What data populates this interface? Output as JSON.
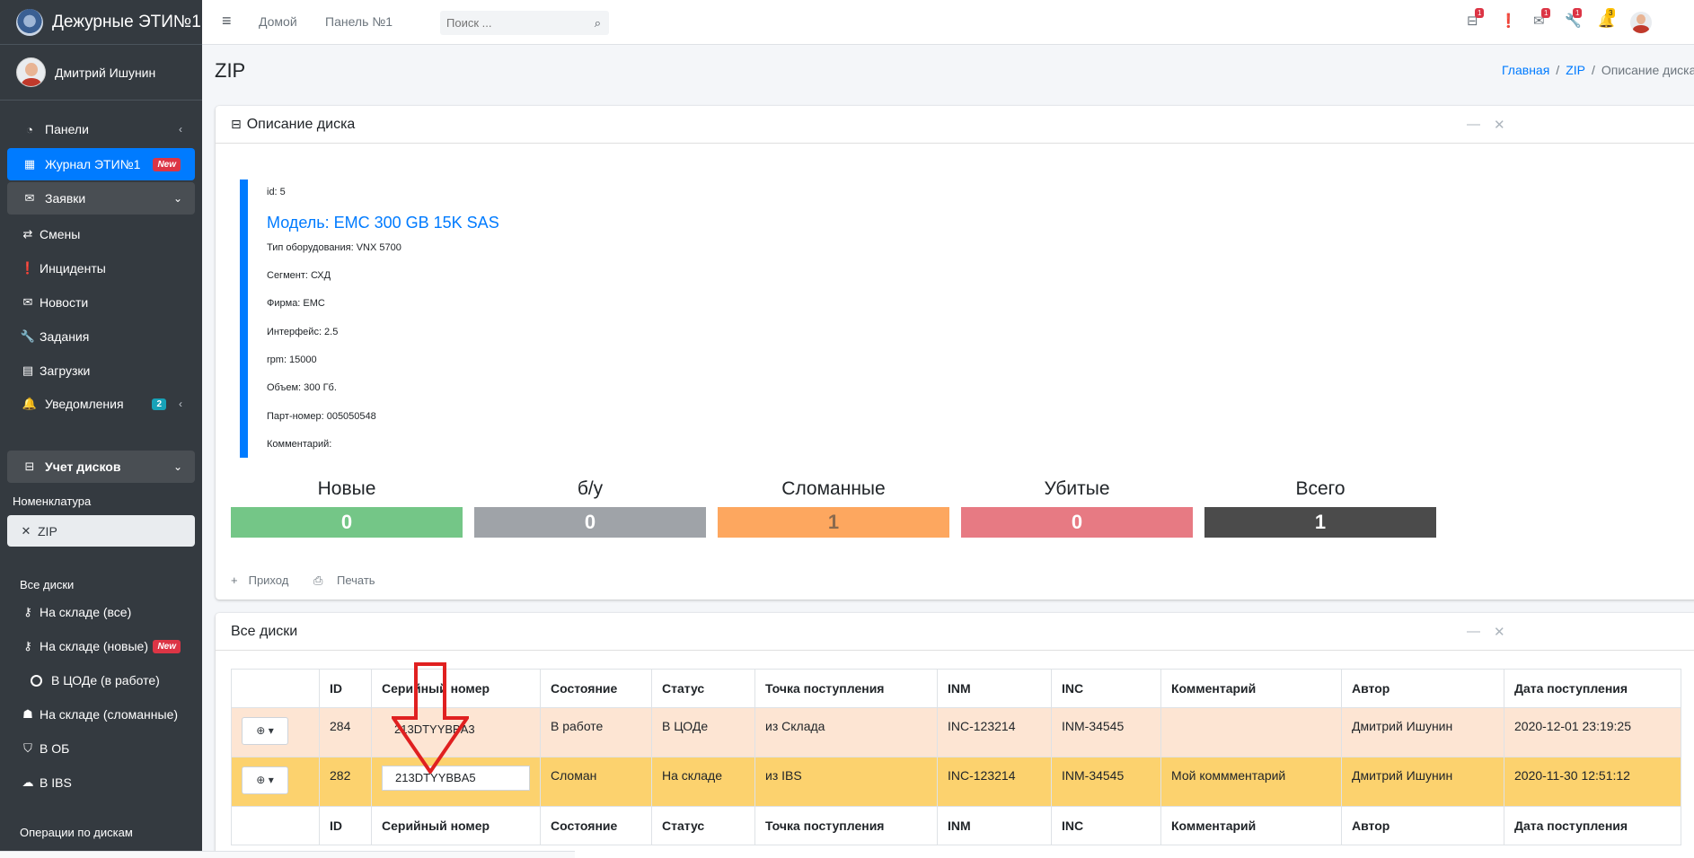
{
  "brand": {
    "title": "Дежурные ЭТИ№1"
  },
  "user": {
    "name": "Дмитрий Ишунин"
  },
  "sidebar": {
    "items": [
      {
        "label": "Панели",
        "icon": "dashboard-icon"
      },
      {
        "label": "Журнал ЭТИ№1",
        "badge": "New",
        "icon": "grid-icon"
      },
      {
        "label": "Заявки",
        "icon": "envelope-icon"
      },
      {
        "label": "Смены",
        "icon": "exchange-icon"
      },
      {
        "label": "Инциденты",
        "icon": "exclamation-circle-icon"
      },
      {
        "label": "Новости",
        "icon": "envelope-open-icon"
      },
      {
        "label": "Задания",
        "icon": "wrench-icon"
      },
      {
        "label": "Загрузки",
        "icon": "file-icon"
      },
      {
        "label": "Уведомления",
        "badge": "2",
        "icon": "bell-icon"
      },
      {
        "label": "Учет дисков",
        "icon": "hdd-icon"
      }
    ],
    "nomenclature_header": "Номенклатура",
    "zip_item": "ZIP",
    "all_disks_header": "Все диски",
    "disk_items": [
      {
        "label": "На складе (все)",
        "icon": "key-icon"
      },
      {
        "label": "На складе (новые)",
        "badge": "New",
        "icon": "key-icon"
      },
      {
        "label": "В ЦОДе (в работе)",
        "icon": "circle-icon"
      },
      {
        "label": "На складе (сломанные)",
        "icon": "user-injured-icon"
      },
      {
        "label": "В ОБ",
        "icon": "shield-icon"
      },
      {
        "label": "В IBS",
        "icon": "cloud-icon"
      }
    ],
    "operations_header": "Операции по дискам"
  },
  "navbar": {
    "home": "Домой",
    "panel": "Панель №1",
    "search_placeholder": "Поиск ...",
    "badges": [
      "1",
      "1",
      "1",
      "3"
    ]
  },
  "page": {
    "title": "ZIP",
    "breadcrumb": [
      "Главная",
      "ZIP",
      "Описание диска"
    ]
  },
  "disk": {
    "card_title": "Описание диска",
    "id_line": "id: 5",
    "model": "Модель: EMC 300 GB 15K SAS",
    "type": "Тип оборудования: VNX 5700",
    "segment": "Сегмент: СХД",
    "vendor": "Фирма: EMC",
    "interface": "Интерфейс: 2.5",
    "rpm": "rpm: 15000",
    "volume": "Объем: 300 Гб.",
    "part": "Парт-номер: 005050548",
    "comment": "Комментарий:"
  },
  "stats": [
    {
      "label": "Новые",
      "value": "0",
      "color": "#74c687",
      "text": "#ffffff"
    },
    {
      "label": "б/у",
      "value": "0",
      "color": "#9fa3a8",
      "text": "#ffffff"
    },
    {
      "label": "Сломанные",
      "value": "1",
      "color": "#fda75f",
      "text": "#8a6a4e"
    },
    {
      "label": "Убитые",
      "value": "0",
      "color": "#e77a83",
      "text": "#ffffff"
    },
    {
      "label": "Всего",
      "value": "1",
      "color": "#4b4b4b",
      "text": "#ffffff"
    }
  ],
  "actions": {
    "income": "Приход",
    "print": "Печать"
  },
  "table": {
    "card_title": "Все диски",
    "columns": [
      "ID",
      "Серийный номер",
      "Состояние",
      "Статус",
      "Точка поступления",
      "INM",
      "INC",
      "Комментарий",
      "Автор",
      "Дата поступления"
    ],
    "rows": [
      {
        "id": "284",
        "serial": "213DTYYBBA3",
        "state": "В работе",
        "status": "В ЦОДе",
        "source": "из Склада",
        "inm": "INC-123214",
        "inc": "INM-34545",
        "comment": "",
        "author": "Дмитрий Ишунин",
        "date": "2020-12-01 23:19:25"
      },
      {
        "id": "282",
        "serial": "213DTYYBBA5",
        "state": "Сломан",
        "status": "На складе",
        "source": "из IBS",
        "inm": "INC-123214",
        "inc": "INM-34545",
        "comment": "Мой коммментарий",
        "author": "Дмитрий Ишунин",
        "date": "2020-11-30 12:51:12"
      }
    ]
  },
  "colors": {
    "accent": "#007bff",
    "sidebar": "#343a40",
    "arrow": "#e02020"
  }
}
